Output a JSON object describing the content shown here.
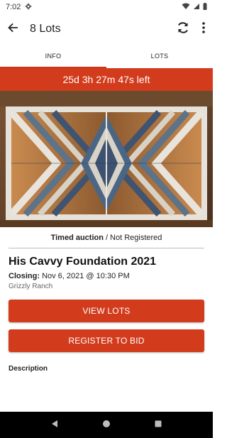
{
  "status_bar": {
    "time": "7:02",
    "icons": [
      "gear-icon",
      "wifi-icon",
      "signal-icon",
      "battery-icon"
    ]
  },
  "app_bar": {
    "title": "8 Lots",
    "back_icon": "arrow-back-icon",
    "refresh_icon": "refresh-icon",
    "menu_icon": "more-vertical-icon"
  },
  "tabs": [
    {
      "label": "INFO",
      "active": true
    },
    {
      "label": "LOTS",
      "active": false
    }
  ],
  "countdown": {
    "text": "25d 3h 27m 47s left"
  },
  "auction": {
    "type": "Timed auction",
    "separator": "/",
    "registration_status": "Not Registered",
    "name": "His Cavvy Foundation 2021",
    "closing_label": "Closing:",
    "closing_value": "Nov 6, 2021 @ 10:30 PM",
    "venue": "Grizzly Ranch"
  },
  "buttons": {
    "view_lots": "VIEW LOTS",
    "register": "REGISTER TO BID"
  },
  "description_label": "Description",
  "colors": {
    "accent": "#d23c1d",
    "tab_indicator": "#c9361b",
    "nav_bar": "#000000"
  },
  "nav_bar": {
    "icons": [
      "back-triangle-icon",
      "home-circle-icon",
      "recents-square-icon"
    ]
  }
}
